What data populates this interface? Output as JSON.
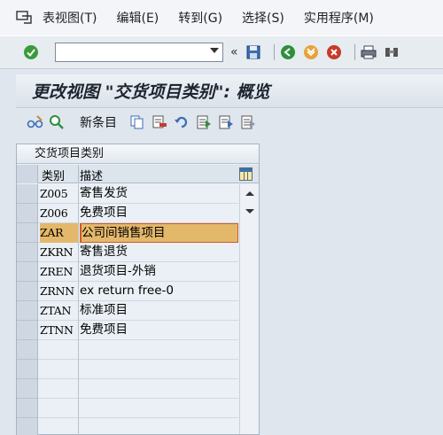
{
  "menubar": {
    "items": [
      "表视图(T)",
      "编辑(E)",
      "转到(G)",
      "选择(S)",
      "实用程序(M)"
    ]
  },
  "toolbar": {
    "command_value": "",
    "back_glyph": "«"
  },
  "title": "更改视图 \"交货项目类别\": 概览",
  "app_toolbar": {
    "new_entries_label": "新条目"
  },
  "table": {
    "title": "交货项目类别",
    "headers": {
      "type": "类别",
      "description": "描述"
    },
    "rows": [
      {
        "code": "Z005",
        "desc": "寄售发货"
      },
      {
        "code": "Z006",
        "desc": "免费项目"
      },
      {
        "code": "ZAR",
        "desc": "公司间销售项目"
      },
      {
        "code": "ZKRN",
        "desc": "寄售退货"
      },
      {
        "code": "ZREN",
        "desc": "退货项目-外销"
      },
      {
        "code": "ZRNN",
        "desc": "ex return free-0"
      },
      {
        "code": "ZTAN",
        "desc": "标准项目"
      },
      {
        "code": "ZTNN",
        "desc": "免费项目"
      }
    ],
    "selected_index": 2,
    "empty_rows": 5
  },
  "colors": {
    "selected_row": "#e4b86b",
    "focus_border": "#d05a2b",
    "enter_icon": "#3a9b3a",
    "nav_icon_green": "#2f8f3a",
    "nav_icon_orange": "#e8a23a",
    "nav_icon_red": "#c83a2a"
  },
  "icons": [
    "menu-icon",
    "enter-icon",
    "save-icon",
    "back-icon",
    "exit-icon",
    "cancel-icon",
    "print-icon",
    "find-icon",
    "edit-glasses-icon",
    "display-change-icon",
    "copy-icon",
    "delete-icon",
    "undo-icon",
    "select-all-icon",
    "select-block-icon",
    "deselect-all-icon",
    "table-config-icon"
  ]
}
